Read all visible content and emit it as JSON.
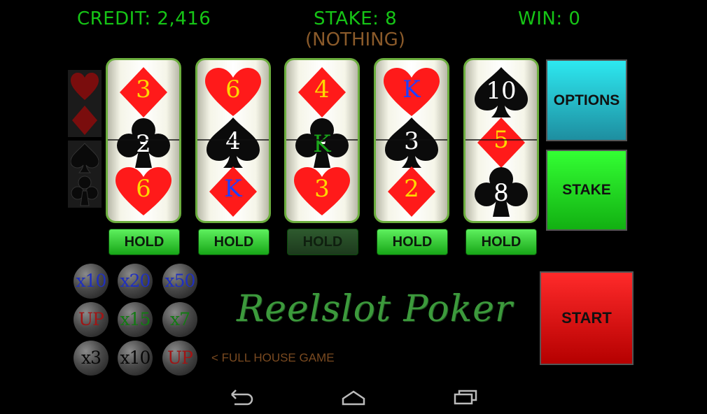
{
  "hud": {
    "credit": "CREDIT: 2,416",
    "stake": "STAKE: 8",
    "win": "WIN: 0",
    "result": "(NOTHING)"
  },
  "colors": {
    "hud_green": "#16c516",
    "result_brown": "#8a5a2a",
    "reel_border": "#6cae3e",
    "red": "#ff1a1a",
    "black": "#111111",
    "rank_gold": "#ffd700",
    "rank_blue": "#1f3fff",
    "rank_green": "#1aa51a"
  },
  "reels": [
    {
      "symbols": [
        {
          "suit": "diamond",
          "rank": "3",
          "rank_color": "gold"
        },
        {
          "suit": "club",
          "rank": "2",
          "rank_color": "white"
        },
        {
          "suit": "heart",
          "rank": "6",
          "rank_color": "gold"
        }
      ]
    },
    {
      "symbols": [
        {
          "suit": "heart",
          "rank": "6",
          "rank_color": "gold"
        },
        {
          "suit": "spade",
          "rank": "4",
          "rank_color": "white"
        },
        {
          "suit": "diamond",
          "rank": "K",
          "rank_color": "blue"
        }
      ]
    },
    {
      "symbols": [
        {
          "suit": "diamond",
          "rank": "4",
          "rank_color": "gold"
        },
        {
          "suit": "club",
          "rank": "K",
          "rank_color": "green"
        },
        {
          "suit": "heart",
          "rank": "3",
          "rank_color": "gold"
        }
      ]
    },
    {
      "symbols": [
        {
          "suit": "heart",
          "rank": "K",
          "rank_color": "blue"
        },
        {
          "suit": "spade",
          "rank": "3",
          "rank_color": "white"
        },
        {
          "suit": "diamond",
          "rank": "2",
          "rank_color": "gold"
        }
      ]
    },
    {
      "symbols": [
        {
          "suit": "spade",
          "rank": "10",
          "rank_color": "white"
        },
        {
          "suit": "diamond",
          "rank": "5",
          "rank_color": "gold"
        },
        {
          "suit": "club",
          "rank": "8",
          "rank_color": "white"
        }
      ]
    }
  ],
  "hold_buttons": [
    {
      "label": "HOLD",
      "active": true
    },
    {
      "label": "HOLD",
      "active": true
    },
    {
      "label": "HOLD",
      "active": false
    },
    {
      "label": "HOLD",
      "active": true
    },
    {
      "label": "HOLD",
      "active": true
    }
  ],
  "buttons": {
    "options": "OPTIONS",
    "stake": "STAKE",
    "start": "START"
  },
  "multipliers": [
    [
      {
        "label": "x10",
        "color": "blue"
      },
      {
        "label": "x20",
        "color": "blue"
      },
      {
        "label": "x50",
        "color": "blue"
      }
    ],
    [
      {
        "label": "UP",
        "color": "red"
      },
      {
        "label": "x15",
        "color": "green"
      },
      {
        "label": "x7",
        "color": "green"
      }
    ],
    [
      {
        "label": "x3",
        "color": "black"
      },
      {
        "label": "x10",
        "color": "black"
      },
      {
        "label": "UP",
        "color": "red"
      }
    ]
  ],
  "game_title": "Reelslot Poker",
  "game_note": "< FULL HOUSE GAME",
  "side_suits": {
    "top": [
      "heart",
      "diamond"
    ],
    "bottom": [
      "spade",
      "club"
    ]
  },
  "nav": {
    "icons": [
      "back-icon",
      "home-icon",
      "recents-icon"
    ]
  }
}
